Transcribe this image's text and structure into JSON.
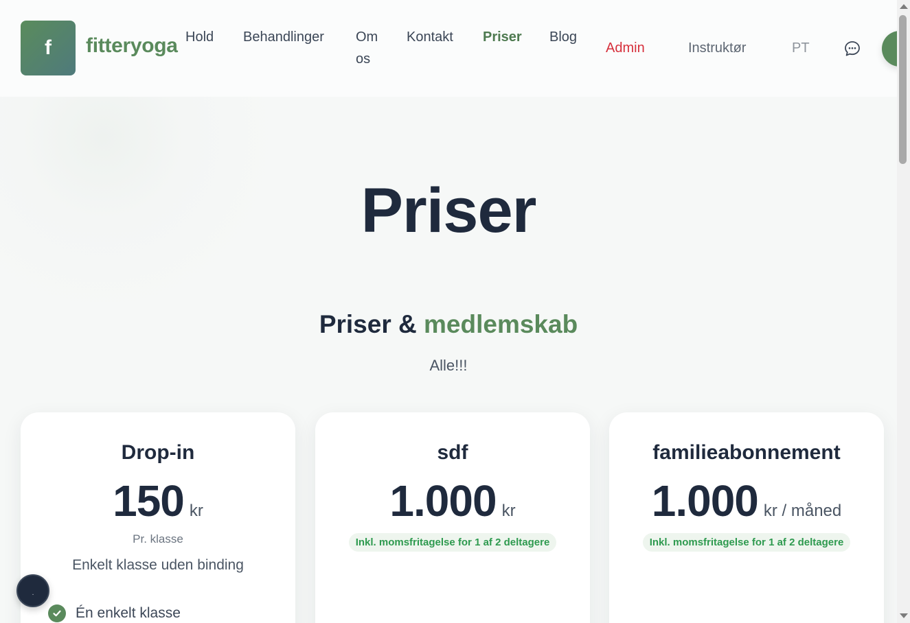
{
  "brand": {
    "logo_letter": "f",
    "name": "fitteryoga"
  },
  "nav": {
    "hold": "Hold",
    "behandlinger": "Behandlinger",
    "om_line1": "Om",
    "om_line2": "os",
    "kontakt": "Kontakt",
    "priser": "Priser",
    "blog": "Blog",
    "admin": "Admin",
    "instruktor": "Instruktør",
    "pt": "PT"
  },
  "hero": {
    "title": "Priser"
  },
  "section": {
    "title_part1": "Priser &",
    "title_accent": "medlemskab",
    "subtitle": "Alle!!!"
  },
  "cards": [
    {
      "title": "Drop-in",
      "price": "150",
      "unit": "kr",
      "note": "Pr. klasse",
      "description": "Enkelt klasse uden binding",
      "feature": "Én enkelt klasse"
    },
    {
      "title": "sdf",
      "price": "1.000",
      "unit": "kr",
      "badge": "Inkl. momsfritagelse for 1 af 2 deltagere"
    },
    {
      "title": "familieabonnement",
      "price": "1.000",
      "unit": "kr / måned",
      "badge": "Inkl. momsfritagelse for 1 af 2 deltagere"
    }
  ],
  "float_button": {
    "label": "."
  },
  "colors": {
    "brand_green": "#5a8a5c",
    "nav_active": "#4e7a50",
    "admin_red": "#d62f3b",
    "badge_green": "#2e9a4f",
    "dark_text": "#1f2a3d"
  }
}
